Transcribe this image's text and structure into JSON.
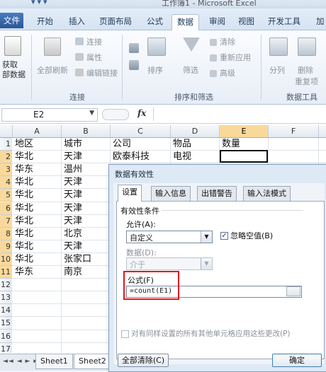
{
  "window": {
    "title": "工作簿1 - Microsoft Excel",
    "qat_icons": [
      "save-icon",
      "undo-icon",
      "redo-icon"
    ]
  },
  "ribbon": {
    "tabs": [
      {
        "label": "文件"
      },
      {
        "label": "开始"
      },
      {
        "label": "插入"
      },
      {
        "label": "页面布局"
      },
      {
        "label": "公式"
      },
      {
        "label": "数据"
      },
      {
        "label": "审阅"
      },
      {
        "label": "视图"
      },
      {
        "label": "开发工具"
      },
      {
        "label": "加"
      }
    ],
    "active_tab": "数据",
    "groups": {
      "get_data": {
        "label": "获取\n部数据"
      },
      "connections": {
        "name": "连接",
        "refresh_all": "全部刷新",
        "connections": "连接",
        "properties": "属性",
        "edit_links": "编辑链接"
      },
      "sort_filter": {
        "name": "排序和筛选",
        "sort": "排序",
        "filter": "筛选",
        "clear": "清除",
        "reapply": "重新应用",
        "advanced": "高级"
      },
      "data_tools": {
        "name": "数据工具",
        "split": "分列",
        "remove": "删除",
        "remove2": "重复项"
      }
    }
  },
  "formula_bar": {
    "name_box": "E2",
    "fx": "fx",
    "value": ""
  },
  "sheet": {
    "columns": [
      "A",
      "B",
      "C",
      "D",
      "E",
      "F"
    ],
    "selected_column": "E",
    "rows": [
      "1",
      "2",
      "3",
      "4",
      "5",
      "6",
      "7",
      "8",
      "9",
      "10",
      "11",
      "12",
      "13",
      "14",
      "15",
      "16",
      "17"
    ],
    "selected_rows": [
      "2",
      "3",
      "4",
      "5",
      "6",
      "7",
      "8",
      "9",
      "10",
      "11"
    ],
    "cells": {
      "A1": "地区",
      "B1": "城市",
      "C1": "公司",
      "D1": "物品",
      "E1": "数量",
      "A2": "华北",
      "B2": "天津",
      "C2": "欧泰科技",
      "D2": "电视",
      "A3": "华东",
      "B3": "温州",
      "A4": "华北",
      "B4": "天津",
      "A5": "华北",
      "B5": "天津",
      "A6": "华北",
      "B6": "天津",
      "A7": "华北",
      "B7": "天津",
      "A8": "华北",
      "B8": "北京",
      "A9": "华北",
      "B9": "天津",
      "A10": "华北",
      "B10": "张家口",
      "A11": "华东",
      "B11": "南京"
    },
    "active_cell": "E2",
    "tabs": [
      "Sheet1",
      "Sheet2"
    ],
    "active_tab": "Sheet2"
  },
  "dialog": {
    "title": "数据有效性",
    "tabs": [
      "设置",
      "输入信息",
      "出错警告",
      "输入法模式"
    ],
    "active_tab": "设置",
    "section": "有效性条件",
    "allow_label": "允许(A):",
    "allow_value": "自定义",
    "ignore_blank": {
      "label": "忽略空值(B)",
      "checked": true
    },
    "data_label": "数据(D):",
    "data_value": "介于",
    "formula_label": "公式(F)",
    "formula_value": "=count(E1)",
    "apply_all": {
      "label": "对有同样设置的所有其他单元格应用这些更改(P)",
      "checked": false
    },
    "clear_all": "全部清除(C)",
    "ok": "确定"
  }
}
